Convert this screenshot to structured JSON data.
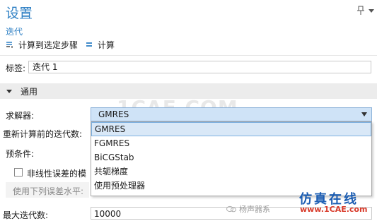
{
  "panel": {
    "title": "设置",
    "subtitle": "迭代"
  },
  "toolbar": {
    "compute_to_selected_label": "计算到选定步骤",
    "compute_label": "计算"
  },
  "label_field": {
    "label": "标签:",
    "value": "迭代 1"
  },
  "section": {
    "title": "通用"
  },
  "solver": {
    "label": "求解器:",
    "selected": "GMRES",
    "options": [
      "GMRES",
      "FGMRES",
      "BiCGStab",
      "共轭梯度",
      "使用预处理器"
    ]
  },
  "rows": {
    "restart_label": "重新计算前的迭代数:",
    "preconditioner_label": "预条件:",
    "nonlinear_checkbox_label": "非线性误差的模",
    "error_level_label": "使用下列误差水平:",
    "max_iter_label": "最大迭代数:",
    "max_iter_value": "10000"
  },
  "watermark": {
    "center_text": "1CAE.COM",
    "brand_top": "仿真在线",
    "brand_bottom": "www.1CAE.com",
    "wechat_text": "杨声器系"
  },
  "colors": {
    "accent": "#2d7fc4",
    "select_bg": "#cfe3f7",
    "brand_blue": "#1b5db3",
    "brand_red": "#d83a2a"
  }
}
